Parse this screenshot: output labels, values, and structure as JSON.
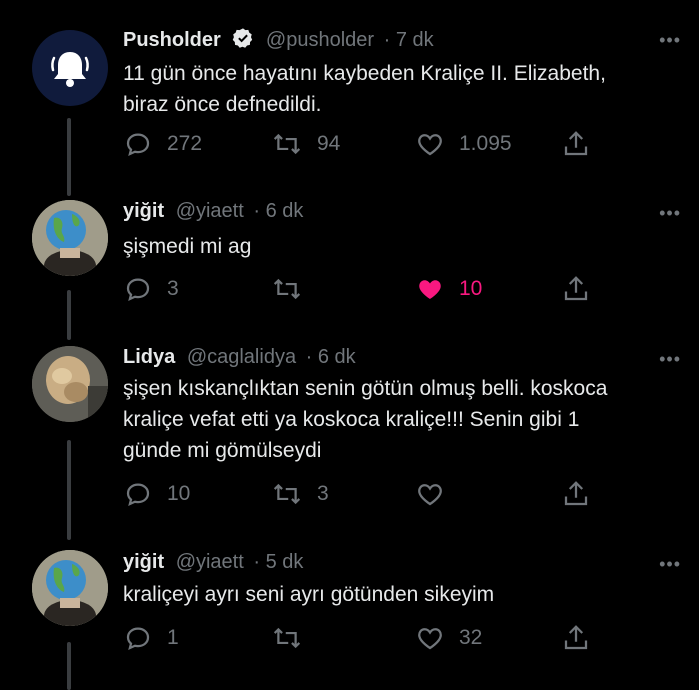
{
  "colors": {
    "background": "#000000",
    "text": "#e7e9ea",
    "muted": "#71767b",
    "like_active": "#f91880",
    "verified": "#e7e9ea"
  },
  "tweets": [
    {
      "name": "Pusholder",
      "verified": true,
      "handle": "@pusholder",
      "time": "· 7 dk",
      "avatar": "bell-logo",
      "text_lines": [
        "11 gün önce hayatını kaybeden Kraliçe II. Elizabeth,",
        "biraz önce defnedildi."
      ],
      "replies": "272",
      "retweets": "94",
      "likes": "1.095",
      "liked": false
    },
    {
      "name": "yiğit",
      "verified": false,
      "handle": "@yiaett",
      "time": "· 6 dk",
      "avatar": "globe-avatar",
      "text_lines": [
        "şişmedi mi ag"
      ],
      "replies": "3",
      "retweets": "",
      "likes": "10",
      "liked": true
    },
    {
      "name": "Lidya",
      "verified": false,
      "handle": "@caglalidya",
      "time": "· 6 dk",
      "avatar": "photo-avatar",
      "text_lines": [
        "şişen kıskançlıktan senin götün olmuş belli. koskoca",
        "kraliçe vefat etti ya koskoca kraliçe!!! Senin gibi 1",
        "günde mi gömülseydi"
      ],
      "replies": "10",
      "retweets": "3",
      "likes": "",
      "liked": false
    },
    {
      "name": "yiğit",
      "verified": false,
      "handle": "@yiaett",
      "time": "· 5 dk",
      "avatar": "globe-avatar",
      "text_lines": [
        "kraliçeyi ayrı seni ayrı götünden sikeyim"
      ],
      "replies": "1",
      "retweets": "",
      "likes": "32",
      "liked": false
    }
  ]
}
